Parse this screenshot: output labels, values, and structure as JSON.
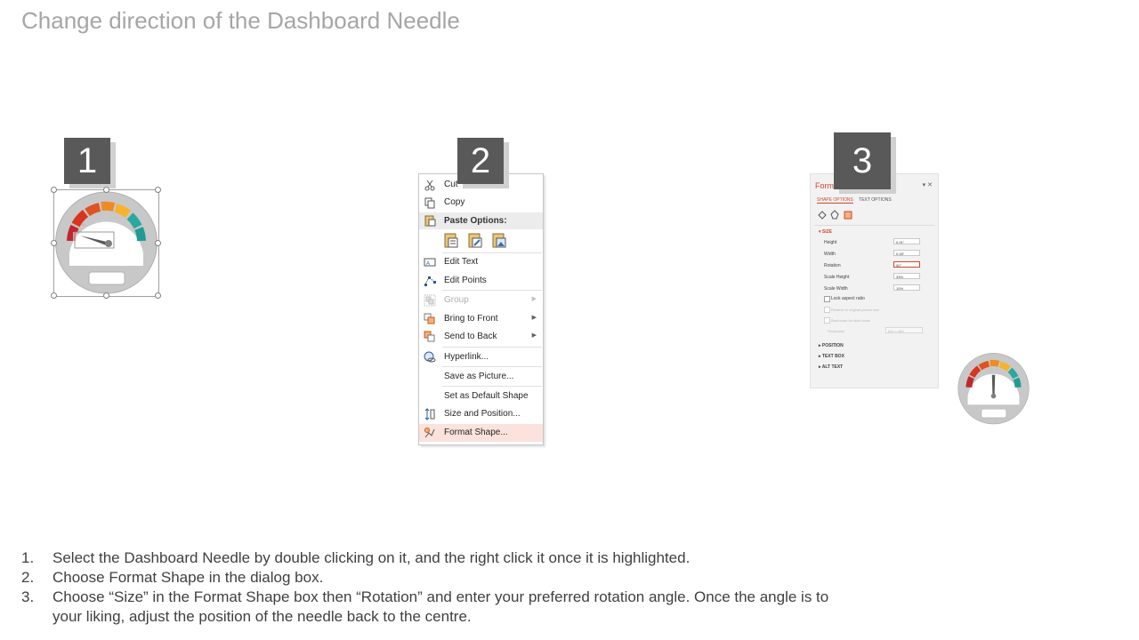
{
  "title": "Change direction of the Dashboard Needle",
  "badges": [
    "1",
    "2",
    "3"
  ],
  "context_menu": {
    "cut": "Cut",
    "copy": "Copy",
    "paste_options": "Paste Options:",
    "edit_text": "Edit Text",
    "edit_points": "Edit Points",
    "group": "Group",
    "bring_to_front": "Bring to Front",
    "send_to_back": "Send to Back",
    "hyperlink": "Hyperlink...",
    "save_as_picture": "Save as Picture...",
    "set_default_shape": "Set as Default Shape",
    "size_position": "Size and Position...",
    "format_shape": "Format Shape..."
  },
  "format_panel": {
    "title": "Format",
    "tab_shape": "SHAPE OPTIONS",
    "tab_text": "TEXT OPTIONS",
    "section_size": "SIZE",
    "height_label": "Height",
    "height_value": "0.91\"",
    "width_label": "Width",
    "width_value": "0.28\"",
    "rotation_label": "Rotation",
    "rotation_value": "90°",
    "scale_height_label": "Scale Height",
    "scale_height_value": "33%",
    "scale_width_label": "Scale Width",
    "scale_width_value": "10%",
    "lock_aspect": "Lock aspect ratio",
    "relative_original": "Relative to original picture size",
    "best_scale": "Best scale for slide show",
    "resolution_label": "Resolution",
    "resolution_value": "640 x 480",
    "section_position": "POSITION",
    "section_text_box": "TEXT BOX",
    "section_alt_text": "ALT TEXT"
  },
  "steps": [
    {
      "num": "1.",
      "text": "Select the Dashboard Needle by double clicking on it, and the right click it once it is highlighted."
    },
    {
      "num": "2.",
      "text": "Choose Format Shape in the dialog box."
    },
    {
      "num": "3.",
      "text": "Choose “Size” in the Format Shape box then “Rotation” and enter your preferred rotation angle. Once the angle is to your liking, adjust the position of the needle back to the centre."
    }
  ],
  "colors": {
    "badge_bg": "#595959",
    "accent": "#d24726",
    "gauge_segments": [
      "#c0272d",
      "#e0521f",
      "#f08a24",
      "#f7b32b",
      "#f6cf3a",
      "#2aa8a0",
      "#1f9c95"
    ]
  }
}
